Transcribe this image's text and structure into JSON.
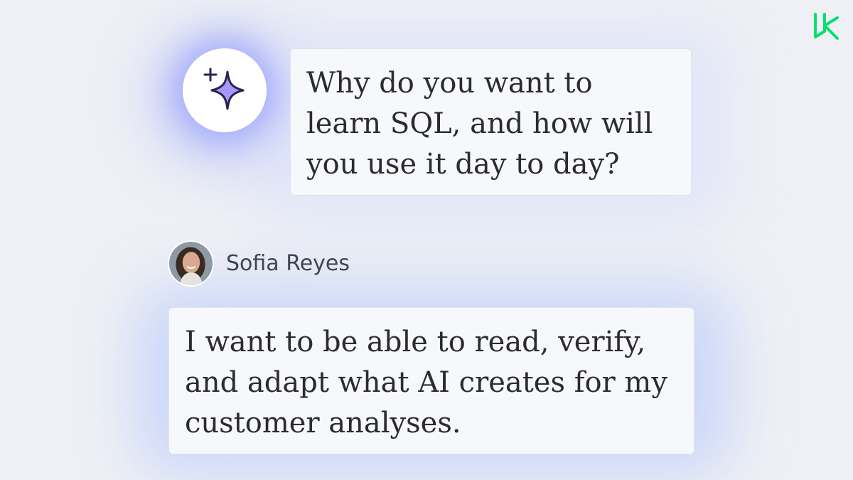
{
  "brand": {
    "logo_icon": "datacamp-logo-icon",
    "accent_color": "#05e06a"
  },
  "assistant": {
    "avatar_icon": "sparkle-icon",
    "sparkle_color": "#9b8af5",
    "question": "Why do you want to learn SQL, and how will you use it day to day?"
  },
  "user": {
    "name": "Sofia Reyes",
    "answer": "I want to be able to read, verify, and adapt what AI creates for my customer analyses."
  }
}
